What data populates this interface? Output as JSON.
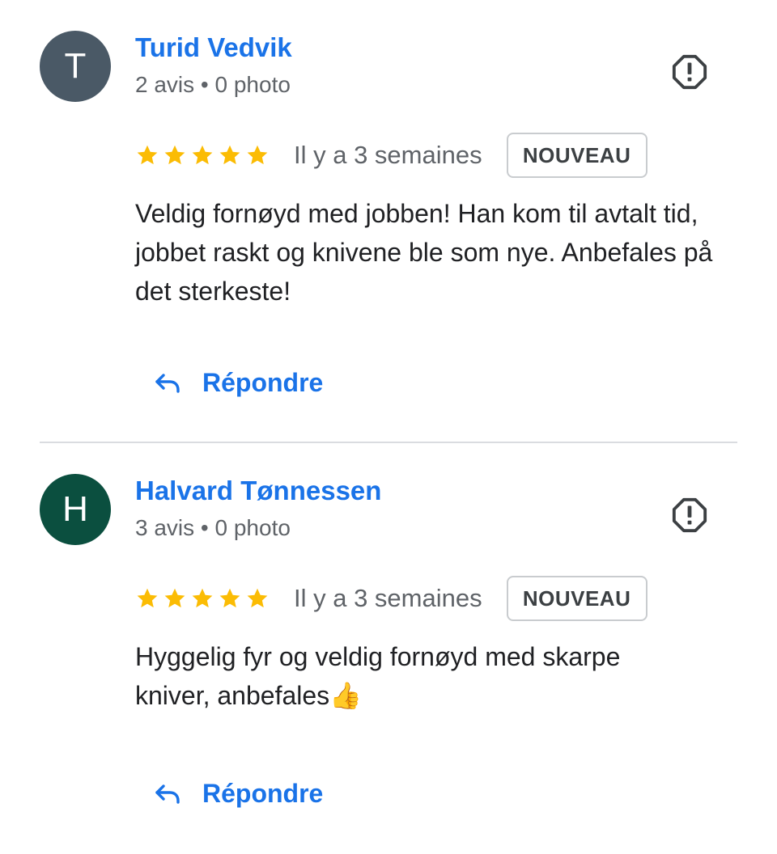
{
  "colors": {
    "link_blue": "#1a73e8",
    "star_yellow": "#fbbc04",
    "divider": "#dadce0",
    "secondary_text": "#5f6368"
  },
  "reviews": [
    {
      "avatar_letter": "T",
      "avatar_color": "#4a5966",
      "name": "Turid Vedvik",
      "meta": "2 avis • 0 photo",
      "report_icon": "report-flag-icon",
      "rating": 5,
      "date": "Il y a 3 semaines",
      "badge": "NOUVEAU",
      "text": "Veldig fornøyd med jobben! Han kom til avtalt tid, jobbet raskt og knivene ble som nye. Anbefales på det sterkeste!",
      "reply_label": "Répondre"
    },
    {
      "avatar_letter": "H",
      "avatar_color": "#0b4f3f",
      "name": "Halvard Tønnessen",
      "meta": "3 avis • 0 photo",
      "report_icon": "report-flag-icon",
      "rating": 5,
      "date": "Il y a 3 semaines",
      "badge": "NOUVEAU",
      "text": "Hyggelig fyr og veldig fornøyd med skarpe kniver, anbefales👍",
      "reply_label": "Répondre"
    }
  ]
}
